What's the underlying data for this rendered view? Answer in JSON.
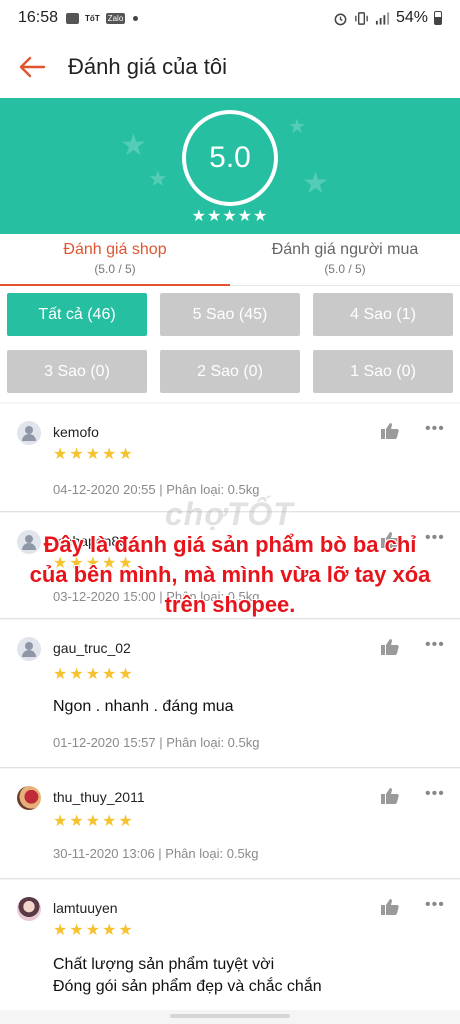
{
  "status": {
    "time": "16:58",
    "icon_labels": [
      "TốT",
      "Zalo"
    ],
    "battery": "54%"
  },
  "header": {
    "title": "Đánh giá của tôi"
  },
  "summary": {
    "score": "5.0",
    "stars": "★★★★★"
  },
  "tabs": [
    {
      "label": "Đánh giá shop",
      "sub": "(5.0 / 5)",
      "active": true
    },
    {
      "label": "Đánh giá người mua",
      "sub": "(5.0 / 5)",
      "active": false
    }
  ],
  "filters": [
    {
      "label": "Tất cả (46)",
      "active": true
    },
    {
      "label": "5 Sao (45)",
      "active": false
    },
    {
      "label": "4 Sao (1)",
      "active": false
    },
    {
      "label": "3 Sao (0)",
      "active": false
    },
    {
      "label": "2 Sao (0)",
      "active": false
    },
    {
      "label": "1 Sao (0)",
      "active": false
    }
  ],
  "reviews": [
    {
      "user": "kemofo",
      "stars": "★★★★★",
      "text": "",
      "meta": "04-12-2020 20:55 | Phân loại: 0.5kg",
      "rating": 5
    },
    {
      "user": "mebapon88",
      "stars": "★★★★★",
      "text": "",
      "meta": "03-12-2020 15:00 | Phân loại: 0.5kg",
      "rating": 5
    },
    {
      "user": "gau_truc_02",
      "stars": "★★★★★",
      "text": "Ngon . nhanh . đáng mua",
      "meta": "01-12-2020 15:57 | Phân loại: 0.5kg",
      "rating": 5
    },
    {
      "user": "thu_thuy_2011",
      "stars": "★★★★★",
      "text": "",
      "meta": "30-11-2020 13:06 | Phân loại: 0.5kg",
      "rating": 5
    },
    {
      "user": "lamtuuyen",
      "stars": "★★★★★",
      "text": "Chất lượng sản phẩm tuyệt vời",
      "text2": "Đóng gói sản phẩm đẹp và chắc chắn",
      "meta": "",
      "rating": 5
    }
  ],
  "overlay": {
    "line1": "Đây là đánh giá sản phẩm bò ba chỉ",
    "line2": "của bên mình, mà mình vừa lỡ tay xóa",
    "line3": "trên shopee."
  },
  "watermark": "chợTỐT",
  "colors": {
    "accent": "#e0552f",
    "teal": "#26bfa2",
    "star": "#f6c330",
    "overlay_text": "#e8141b"
  }
}
